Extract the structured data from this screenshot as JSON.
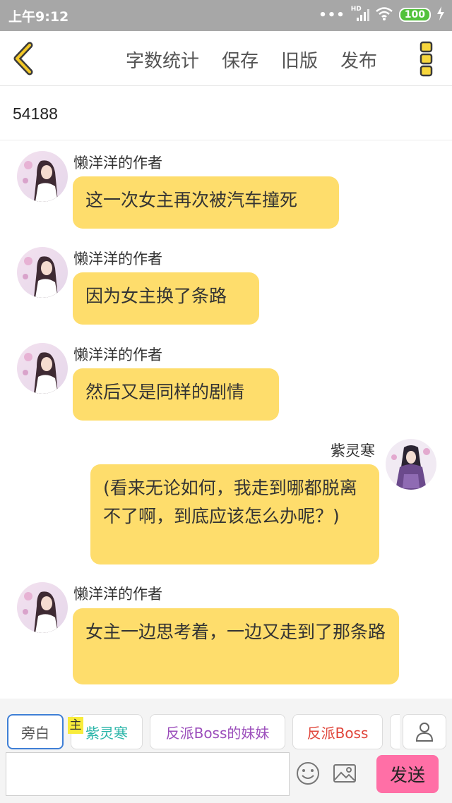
{
  "status_bar": {
    "time": "上午9:12",
    "signal_label": "HD",
    "battery": "100"
  },
  "toolbar": {
    "actions": [
      "字数统计",
      "保存",
      "旧版",
      "发布"
    ]
  },
  "word_count": "54188",
  "messages": [
    {
      "sender": "懒洋洋的作者",
      "side": "left",
      "text": "这一次女主再次被汽车撞死"
    },
    {
      "sender": "懒洋洋的作者",
      "side": "left",
      "text": "因为女主换了条路"
    },
    {
      "sender": "懒洋洋的作者",
      "side": "left",
      "text": "然后又是同样的剧情"
    },
    {
      "sender": "紫灵寒",
      "side": "right",
      "text": "(看来无论如何，我走到哪都脱离不了啊，到底应该怎么办呢？)"
    },
    {
      "sender": "懒洋洋的作者",
      "side": "left",
      "text": "女主一边思考着，一边又走到了那条路"
    }
  ],
  "characters": {
    "main_tag": "主",
    "items": [
      {
        "label": "旁白",
        "color": "#555555"
      },
      {
        "label": "紫灵寒",
        "color": "#29b5a8"
      },
      {
        "label": "反派Boss的妹妹",
        "color": "#9b4dbb"
      },
      {
        "label": "反派Boss",
        "color": "#e0453a"
      }
    ]
  },
  "composer": {
    "placeholder": "",
    "send_label": "发送"
  },
  "colors": {
    "bubble": "#fedd6c",
    "send": "#ff6fa6",
    "accent": "#f0c419"
  }
}
